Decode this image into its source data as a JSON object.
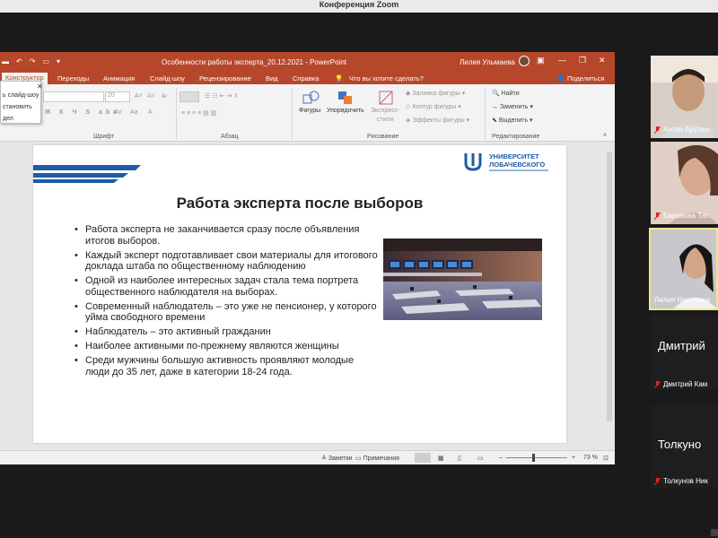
{
  "zoom": {
    "title": "Конференция Zoom"
  },
  "ppt": {
    "doc_title": "Особенности работы эксперта_20.12.2021  -  PowerPoint",
    "user": "Лилия Ульмаева",
    "tabs": [
      "Конструктор",
      "Переходы",
      "Анимация",
      "Слайд-шоу",
      "Рецензирование",
      "Вид",
      "Справка"
    ],
    "tell_me": "Что вы хотите сделать?",
    "share": "Поделиться",
    "dropdown_items": [
      "ь слайд-шоу",
      "становить",
      "дел"
    ],
    "groups": {
      "font": "Шрифт",
      "paragraph": "Абзац",
      "drawing": "Рисование",
      "editing": "Редактирование"
    },
    "font_size": "20",
    "ribbon": {
      "shapes": "Фигуры",
      "arrange": "Упорядочить",
      "quick_styles_1": "Экспресс-",
      "quick_styles_2": "стили",
      "fill": "Заливка фигуры",
      "outline": "Контур фигуры",
      "effects": "Эффекты фигуры",
      "find": "Найти",
      "replace": "Заменить",
      "select": "Выделить"
    },
    "status": {
      "notes": "Заметки",
      "comments": "Примечания",
      "zoom": "73 %"
    }
  },
  "slide": {
    "logo_line1": "УНИВЕРСИТЕТ",
    "logo_line2": "ЛОБАЧЕВСКОГО",
    "title": "Работа эксперта после выборов",
    "bullets": [
      "Работа эксперта не заканчивается сразу после объявления итогов выборов.",
      "Каждый эксперт подготавливает свои материалы для итогового доклада штаба по общественному наблюдению",
      "Одной из наиболее интересных задач стала тема портрета общественного наблюдателя на выборах.",
      "Современный наблюдатель – это уже не пенсионер, у которого уйма свободного времени",
      "Наблюдатель – это активный гражданин",
      "Наиболее активными по-прежнему являются женщины",
      "Среди мужчины большую активность проявляют молодые люди до 35 лет, даже в категории 18-24 года."
    ]
  },
  "participants": [
    {
      "name": "Антон Арутюн"
    },
    {
      "name": "Баранова Тат"
    },
    {
      "name": "Лилия Наилевна"
    },
    {
      "name": "Дмитрий Кам",
      "big": "Дмитрий"
    },
    {
      "name": "Толкунов Ник",
      "big": "Толкуно"
    }
  ],
  "colors": {
    "ppt_accent": "#b7472a",
    "active_speaker": "#f0e68c",
    "mic_muted": "#e02020"
  }
}
